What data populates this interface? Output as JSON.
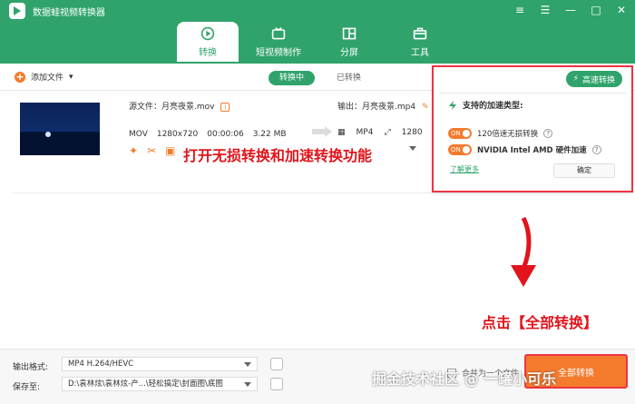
{
  "app": {
    "title": "数据蛙视频转换器"
  },
  "window_controls": [
    "≡",
    "☰",
    "—",
    "□",
    "✕"
  ],
  "tabs": [
    {
      "label": "转换",
      "icon": "convert-icon",
      "active": true
    },
    {
      "label": "短视频制作",
      "icon": "tv-icon",
      "active": false
    },
    {
      "label": "分屏",
      "icon": "split-screen-icon",
      "active": false
    },
    {
      "label": "工具",
      "icon": "toolbox-icon",
      "active": false
    }
  ],
  "toolbar": {
    "add_file": "添加文件",
    "converting": "转换中",
    "converted": "已转换"
  },
  "speed_panel": {
    "button": "高速转换",
    "title": "支持的加速类型:",
    "option1": "120倍速无损转换",
    "option2_label": "NVIDIA   Intel   AMD  硬件加速",
    "toggle_text": "ON",
    "learn_more": "了解更多",
    "confirm": "确定"
  },
  "file": {
    "source": "源文件：月亮夜景.mov",
    "format": "MOV",
    "resolution": "1280x720",
    "duration": "00:00:06",
    "size": "3.22 MB",
    "output": "输出：月亮夜景.mp4",
    "out_format": "MP4",
    "out_resolution": "1280"
  },
  "annotations": {
    "open_lossless": "打开无损转换和加速转换功能",
    "click_convert_all": "点击【全部转换】"
  },
  "bottom": {
    "output_format_label": "输出格式:",
    "output_format_value": "MP4 H.264/HEVC",
    "save_to_label": "保存至:",
    "save_to_value": "D:\\袁林炫\\袁林炫-产...\\轻松搞定\\封面图\\底图",
    "merge_label": "合并为一个文件",
    "convert_all": "全部转换",
    "watermark": "掘金技术社区 @ 一罐小可乐"
  },
  "colors": {
    "brand_green": "#2fa36b",
    "accent_orange": "#f47a2c",
    "highlight_red": "#e33344"
  }
}
